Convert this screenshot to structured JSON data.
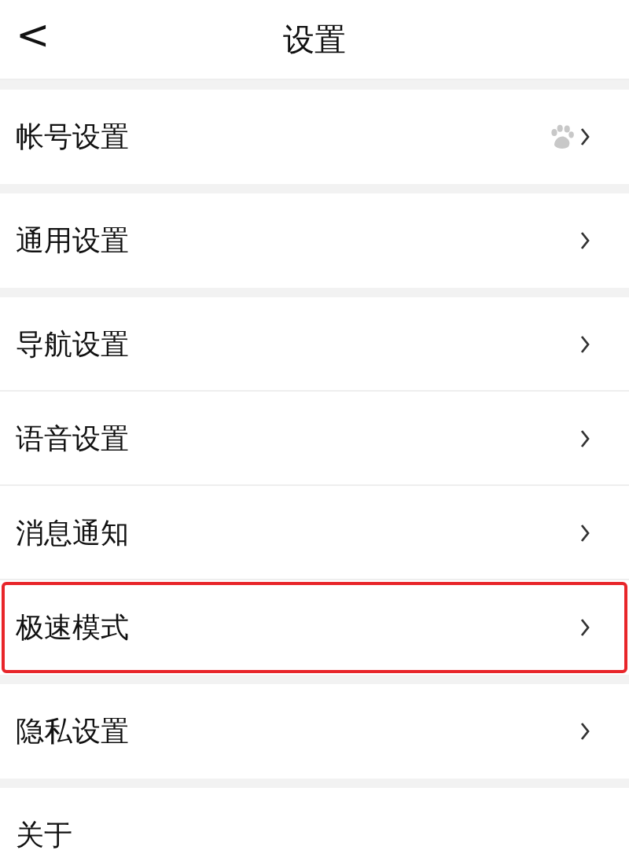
{
  "header": {
    "back": "<",
    "title": "设置"
  },
  "groups": [
    {
      "items": [
        {
          "label": "帐号设置",
          "kind": "account",
          "chevron": true,
          "highlighted": false
        }
      ]
    },
    {
      "items": [
        {
          "label": "通用设置",
          "kind": "plain",
          "chevron": true,
          "highlighted": false
        }
      ]
    },
    {
      "items": [
        {
          "label": "导航设置",
          "kind": "plain",
          "chevron": true,
          "highlighted": false
        },
        {
          "label": "语音设置",
          "kind": "plain",
          "chevron": true,
          "highlighted": false
        },
        {
          "label": "消息通知",
          "kind": "plain",
          "chevron": true,
          "highlighted": false
        },
        {
          "label": "极速模式",
          "kind": "plain",
          "chevron": true,
          "highlighted": true
        }
      ]
    },
    {
      "items": [
        {
          "label": "隐私设置",
          "kind": "plain",
          "chevron": true,
          "highlighted": false
        }
      ]
    },
    {
      "items": [
        {
          "label": "关于",
          "kind": "plain",
          "chevron": false,
          "highlighted": false
        }
      ]
    }
  ]
}
